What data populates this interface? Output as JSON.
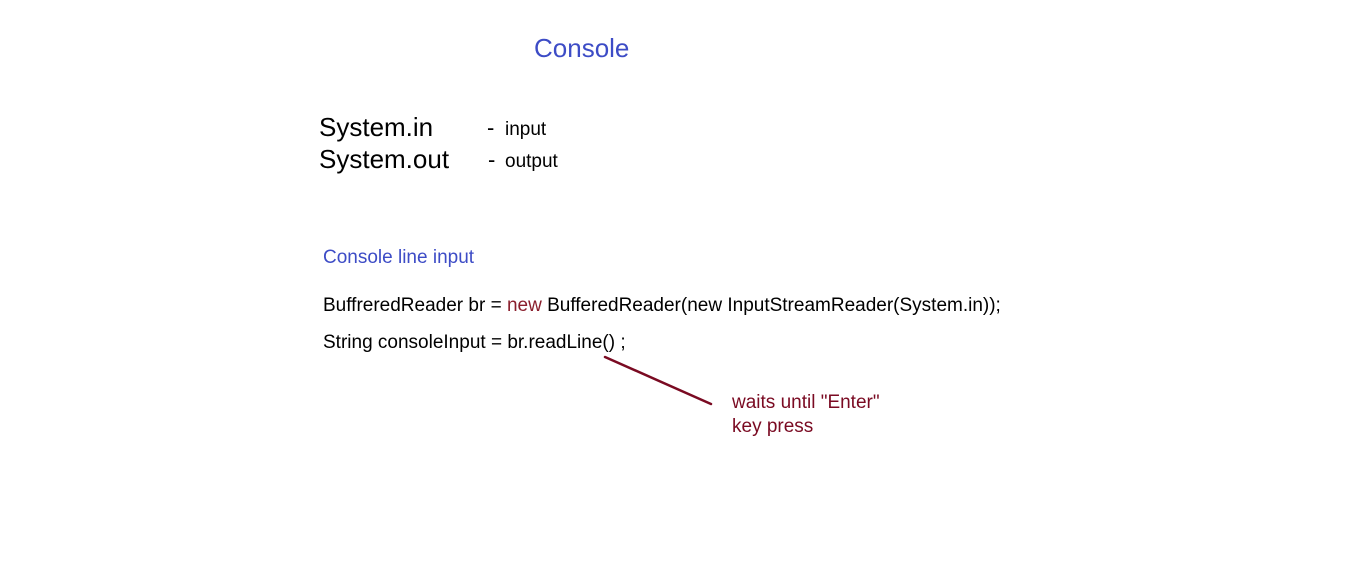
{
  "slide": {
    "title": "Console",
    "streams": [
      {
        "name": "System.in",
        "dash": "-",
        "description": "input"
      },
      {
        "name": "System.out",
        "dash": "-",
        "description": "output"
      }
    ],
    "section_title": "Console line input",
    "code": {
      "line1_prefix": "BuffreredReader br = ",
      "line1_keyword": "new",
      "line1_suffix": " BufferedReader(new InputStreamReader(System.in));",
      "line2": "String consoleInput  = br.readLine() ;"
    },
    "annotation": {
      "line1": "waits until \"Enter\"",
      "line2": "key press"
    },
    "colors": {
      "title": "#3d4cc6",
      "keyword": "#8a1f2d",
      "annotation": "#7a0a22"
    }
  }
}
